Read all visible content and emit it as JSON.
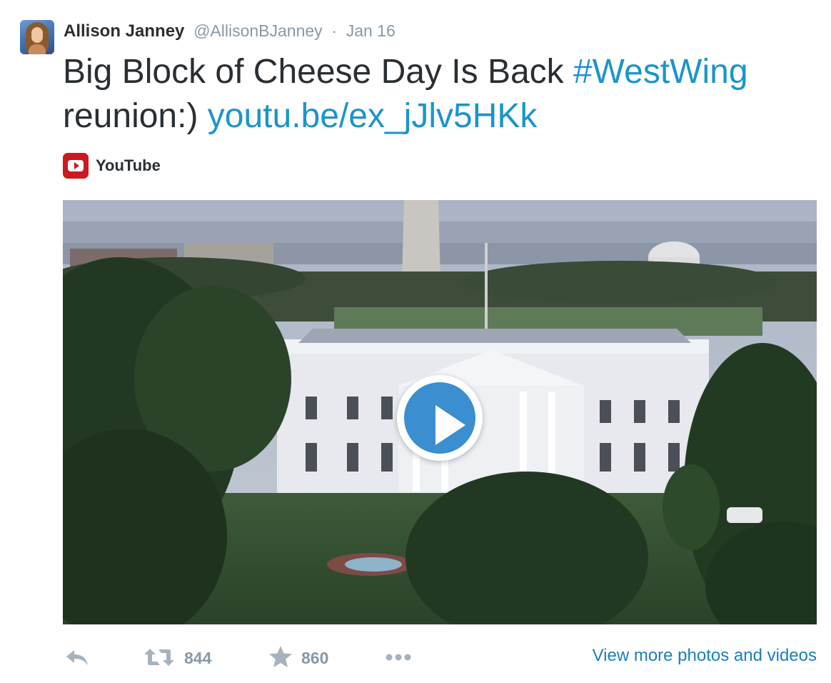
{
  "tweet": {
    "author_name": "Allison Janney",
    "author_handle": "@AllisonBJanney",
    "separator": "·",
    "date": "Jan 16",
    "text_plain_1": "Big Block of Cheese Day Is Back ",
    "hashtag": "#WestWing",
    "text_plain_2": "reunion:) ",
    "link": "youtu.be/ex_jJlv5HKk"
  },
  "card": {
    "source_label": "YouTube",
    "media_description_icon": "play-button-icon"
  },
  "actions": {
    "reply_icon": "reply-icon",
    "retweet_icon": "retweet-icon",
    "retweet_count": "844",
    "favorite_icon": "star-icon",
    "favorite_count": "860",
    "more_icon": "more-dots-icon",
    "view_more_label": "View more photos and videos"
  },
  "colors": {
    "link": "#1b95c8",
    "muted": "#8899a6",
    "text": "#292f33",
    "youtube_red": "#cc181e",
    "play_blue": "#3b8ed0"
  }
}
